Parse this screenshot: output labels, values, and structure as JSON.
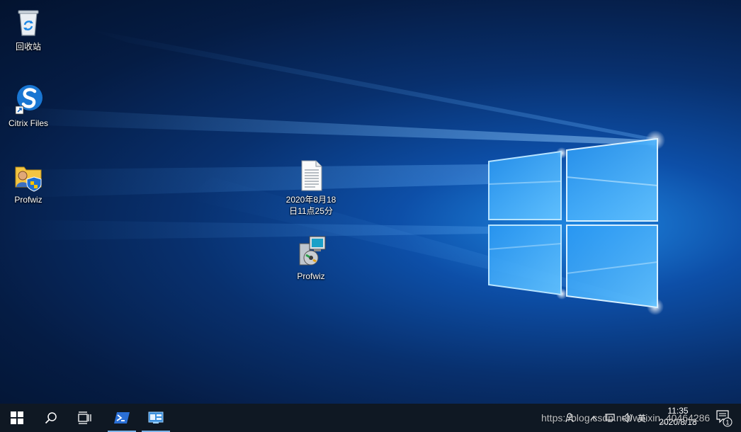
{
  "desktop_icons": [
    {
      "name": "recycle-bin-icon",
      "label": "回收站"
    },
    {
      "name": "citrix-files-icon",
      "label": "Citrix Files"
    },
    {
      "name": "profwiz-shortcut-icon",
      "label": "Profwiz"
    },
    {
      "name": "text-document-icon",
      "label": "2020年8月18\n日11点25分"
    },
    {
      "name": "profwiz-installer-icon",
      "label": "Profwiz"
    }
  ],
  "taskbar": {
    "start_icon": "windows-start-icon",
    "search_icon": "search-icon",
    "task_view_icon": "task-view-icon",
    "apps": [
      {
        "name": "powershell-icon"
      },
      {
        "name": "server-manager-icon"
      }
    ]
  },
  "tray": {
    "ime_label": "英",
    "time": "11:35",
    "date": "2020/8/18",
    "notification_count": "1"
  },
  "watermark": "https://blog.csdn.net/weixin_40464286",
  "colors": {
    "taskbar_bg": "#0f1823",
    "accent": "#7db5ea"
  }
}
